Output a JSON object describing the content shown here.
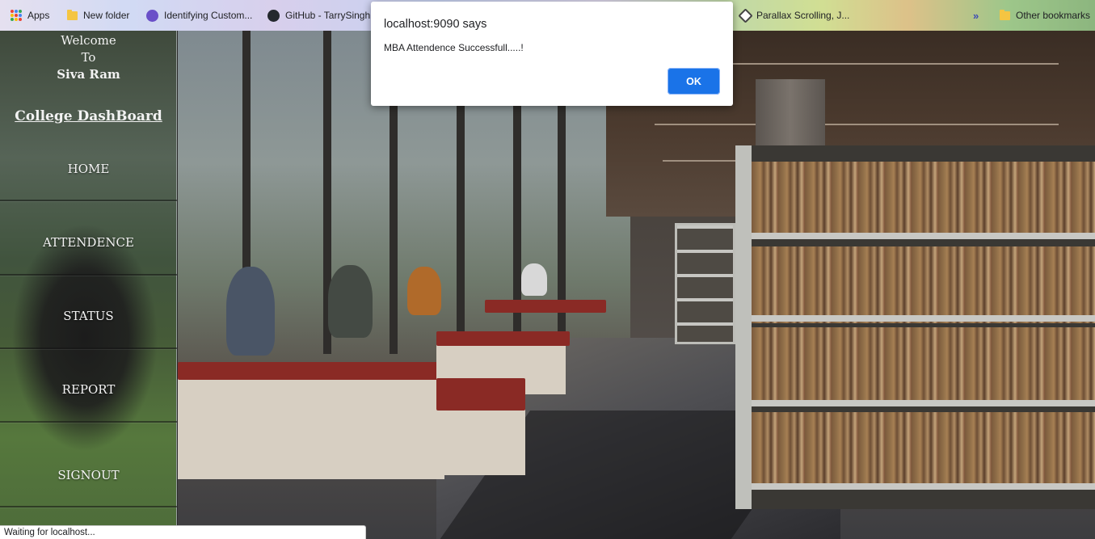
{
  "bookmarks": {
    "items": [
      {
        "label": "Apps",
        "icon": "apps-grid-icon"
      },
      {
        "label": "New folder",
        "icon": "folder-icon"
      },
      {
        "label": "Identifying Custom...",
        "icon": "site-icon"
      },
      {
        "label": "GitHub - TarrySingh",
        "icon": "github-icon"
      },
      {
        "label": "Parallax Scrolling, J...",
        "icon": "site-icon"
      },
      {
        "label": "Other bookmarks",
        "icon": "folder-icon"
      }
    ],
    "overflow_label": "»"
  },
  "sidebar": {
    "welcome_line1": "Welcome",
    "welcome_line2": "To",
    "user_name": "Siva Ram",
    "dashboard_title": "College DashBoard",
    "nav": [
      {
        "label": "HOME"
      },
      {
        "label": "ATTENDENCE"
      },
      {
        "label": "STATUS"
      },
      {
        "label": "REPORT"
      },
      {
        "label": "SIGNOUT"
      }
    ]
  },
  "dialog": {
    "title": "localhost:9090 says",
    "message": "MBA Attendence Successfull.....!",
    "ok_label": "OK"
  },
  "status_bar": {
    "text": "Waiting for localhost..."
  },
  "colors": {
    "dialog_button": "#1a73e8",
    "folder": "#f5c542"
  }
}
